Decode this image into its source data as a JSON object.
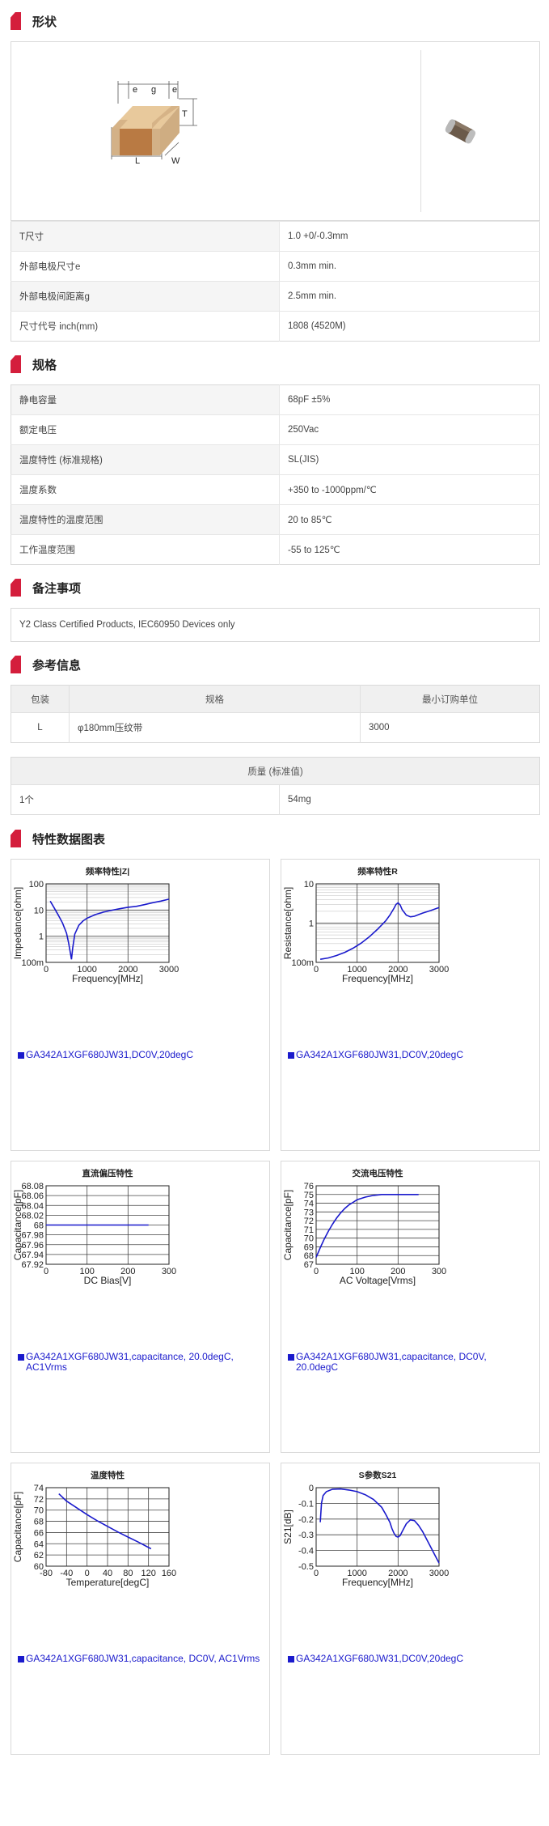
{
  "sections": {
    "shape": "形状",
    "spec": "规格",
    "notes": "备注事项",
    "reference": "参考信息",
    "charts": "特性数据图表"
  },
  "dimension_labels": {
    "e1": "e",
    "g": "g",
    "e2": "e",
    "T": "T",
    "L": "L",
    "W": "W"
  },
  "shape_table": [
    {
      "k": "T尺寸",
      "v": "1.0 +0/-0.3mm"
    },
    {
      "k": "外部电极尺寸e",
      "v": "0.3mm min."
    },
    {
      "k": "外部电极间距离g",
      "v": "2.5mm min."
    },
    {
      "k": "尺寸代号 inch(mm)",
      "v": "1808 (4520M)"
    }
  ],
  "spec_table": [
    {
      "k": "静电容量",
      "v": "68pF ±5%"
    },
    {
      "k": "额定电压",
      "v": "250Vac"
    },
    {
      "k": "温度特性 (标准规格)",
      "v": "SL(JIS)"
    },
    {
      "k": "温度系数",
      "v": "+350 to -1000ppm/℃"
    },
    {
      "k": "温度特性的温度范围",
      "v": "20 to 85℃"
    },
    {
      "k": "工作温度范围",
      "v": "-55 to 125℃"
    }
  ],
  "note_text": "Y2 Class Certified Products, IEC60950 Devices only",
  "package_table": {
    "headers": [
      "包装",
      "规格",
      "最小订购单位"
    ],
    "row": [
      "L",
      "φ180mm压纹带",
      "3000"
    ]
  },
  "mass_table": {
    "header": "质量 (标准值)",
    "row": [
      "1个",
      "54mg"
    ]
  },
  "colors": {
    "accent": "#d41e3c",
    "curve": "#1a1acc"
  },
  "chart_data": [
    {
      "type": "line",
      "title": "频率特性|Z|",
      "xlabel": "Frequency[MHz]",
      "ylabel": "Impedance[ohm]",
      "xlim": [
        0,
        3000
      ],
      "ylim": [
        0.1,
        100
      ],
      "yscale": "log",
      "xticks": [
        "0",
        "1000",
        "2000",
        "3000"
      ],
      "yticks": [
        "100m",
        "1",
        "10",
        "100"
      ],
      "x": [
        100,
        200,
        300,
        400,
        500,
        550,
        600,
        620,
        650,
        700,
        800,
        900,
        1000,
        1200,
        1400,
        1600,
        1800,
        2000,
        2200,
        2400,
        2600,
        2800,
        3000
      ],
      "y": [
        22,
        12,
        6.3,
        3.2,
        1.3,
        0.55,
        0.2,
        0.13,
        0.35,
        1.2,
        2.6,
        3.8,
        4.9,
        6.7,
        8.3,
        9.8,
        11.2,
        12.8,
        13.8,
        16,
        19,
        22,
        26
      ],
      "legend": "GA342A1XGF680JW31,DC0V,20degC"
    },
    {
      "type": "line",
      "title": "频率特性R",
      "xlabel": "Frequency[MHz]",
      "ylabel": "Resistance[ohm]",
      "xlim": [
        0,
        3000
      ],
      "ylim": [
        0.1,
        10
      ],
      "yscale": "log",
      "xticks": [
        "0",
        "1000",
        "2000",
        "3000"
      ],
      "yticks": [
        "100m",
        "1",
        "10"
      ],
      "x": [
        100,
        300,
        500,
        700,
        900,
        1100,
        1300,
        1500,
        1700,
        1800,
        1900,
        1950,
        2000,
        2050,
        2100,
        2200,
        2300,
        2400,
        2500,
        2600,
        2800,
        3000
      ],
      "y": [
        0.12,
        0.13,
        0.15,
        0.18,
        0.23,
        0.31,
        0.45,
        0.7,
        1.15,
        1.6,
        2.4,
        3,
        3.3,
        2.9,
        2.2,
        1.6,
        1.45,
        1.5,
        1.65,
        1.8,
        2.1,
        2.5
      ],
      "legend": "GA342A1XGF680JW31,DC0V,20degC"
    },
    {
      "type": "line",
      "title": "直流偏压特性",
      "xlabel": "DC Bias[V]",
      "ylabel": "Capacitance[pF]",
      "xlim": [
        0,
        300
      ],
      "ylim": [
        67.92,
        68.08
      ],
      "xticks": [
        "0",
        "100",
        "200",
        "300"
      ],
      "yticks": [
        "67.92",
        "67.94",
        "67.96",
        "67.98",
        "68",
        "68.02",
        "68.04",
        "68.06",
        "68.08"
      ],
      "x": [
        0,
        250
      ],
      "y": [
        68,
        68
      ],
      "legend": "GA342A1XGF680JW31,capacitance, 20.0degC, AC1Vrms"
    },
    {
      "type": "line",
      "title": "交流电压特性",
      "xlabel": "AC Voltage[Vrms]",
      "ylabel": "Capacitance[pF]",
      "xlim": [
        0,
        300
      ],
      "ylim": [
        67,
        76
      ],
      "xticks": [
        "0",
        "100",
        "200",
        "300"
      ],
      "yticks": [
        "67",
        "68",
        "69",
        "70",
        "71",
        "72",
        "73",
        "74",
        "75",
        "76"
      ],
      "x": [
        0,
        10,
        20,
        30,
        40,
        50,
        60,
        70,
        80,
        90,
        100,
        120,
        140,
        160,
        180,
        200,
        220,
        250
      ],
      "y": [
        67.8,
        68.9,
        69.9,
        70.8,
        71.6,
        72.3,
        72.9,
        73.4,
        73.8,
        74.1,
        74.4,
        74.7,
        74.9,
        75,
        75,
        75,
        75,
        75
      ],
      "legend": "GA342A1XGF680JW31,capacitance, DC0V, 20.0degC"
    },
    {
      "type": "line",
      "title": "温度特性",
      "xlabel": "Temperature[degC]",
      "ylabel": "Capacitance[pF]",
      "xlim": [
        -80,
        160
      ],
      "ylim": [
        60,
        74
      ],
      "xticks": [
        "-80",
        "-40",
        "0",
        "40",
        "80",
        "120",
        "160"
      ],
      "yticks": [
        "60",
        "62",
        "64",
        "66",
        "68",
        "70",
        "72",
        "74"
      ],
      "x": [
        -55,
        -40,
        -20,
        0,
        20,
        40,
        60,
        80,
        100,
        125
      ],
      "y": [
        72.9,
        71.6,
        70.4,
        69.2,
        68.1,
        67.1,
        66.1,
        65.2,
        64.3,
        63.1
      ],
      "legend": "GA342A1XGF680JW31,capacitance, DC0V, AC1Vrms"
    },
    {
      "type": "line",
      "title": "S参数S21",
      "xlabel": "Frequency[MHz]",
      "ylabel": "S21[dB]",
      "xlim": [
        0,
        3000
      ],
      "ylim": [
        -0.5,
        0
      ],
      "xticks": [
        "0",
        "1000",
        "2000",
        "3000"
      ],
      "yticks": [
        "-0.5",
        "-0.4",
        "-0.3",
        "-0.2",
        "-0.1",
        "0"
      ],
      "x": [
        100,
        130,
        170,
        250,
        400,
        600,
        800,
        1000,
        1200,
        1400,
        1600,
        1700,
        1800,
        1850,
        1900,
        1950,
        2000,
        2050,
        2100,
        2200,
        2300,
        2400,
        2500,
        2600,
        2700,
        2800,
        2900,
        3000
      ],
      "y": [
        -0.22,
        -0.1,
        -0.05,
        -0.025,
        -0.01,
        -0.008,
        -0.015,
        -0.025,
        -0.045,
        -0.075,
        -0.125,
        -0.17,
        -0.22,
        -0.26,
        -0.29,
        -0.31,
        -0.315,
        -0.305,
        -0.28,
        -0.23,
        -0.205,
        -0.21,
        -0.24,
        -0.28,
        -0.33,
        -0.38,
        -0.43,
        -0.48
      ],
      "legend": "GA342A1XGF680JW31,DC0V,20degC"
    }
  ]
}
